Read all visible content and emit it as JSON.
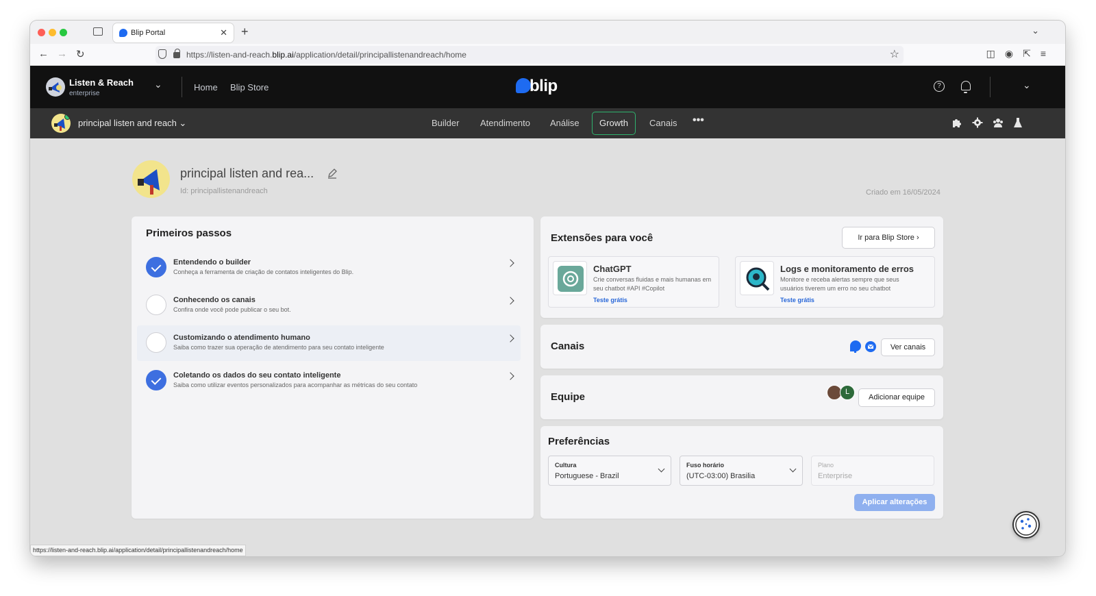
{
  "browser": {
    "tab_title": "Blip Portal",
    "url_prefix": "https://listen-and-reach.",
    "url_domain": "blip.ai",
    "url_path": "/application/detail/principallistenandreach/home",
    "status_url": "https://listen-and-reach.blip.ai/application/detail/principallistenandreach/home"
  },
  "topnav": {
    "tenant_name": "Listen & Reach",
    "tenant_plan": "enterprise",
    "links": [
      "Home",
      "Blip Store"
    ],
    "brand": "blip"
  },
  "subnav": {
    "bot_name": "principal listen and reach",
    "items": [
      "Builder",
      "Atendimento",
      "Análise",
      "Growth",
      "Canais"
    ],
    "active": "Growth"
  },
  "header": {
    "title": "principal listen and rea...",
    "id_text": "Id: principallistenandreach",
    "created_text": "Criado em  16/05/2024"
  },
  "first_steps": {
    "title": "Primeiros passos",
    "steps": [
      {
        "title": "Entendendo o builder",
        "desc": "Conheça a ferramenta de criação de contatos inteligentes do Blip.",
        "done": true
      },
      {
        "title": "Conhecendo os canais",
        "desc": "Confira onde você pode publicar o seu bot.",
        "done": false
      },
      {
        "title": "Customizando o atendimento humano",
        "desc": "Saiba como trazer sua operação de atendimento para seu contato inteligente",
        "done": false
      },
      {
        "title": "Coletando os dados do seu contato inteligente",
        "desc": "Saiba como utilizar eventos personalizados para acompanhar as métricas do seu contato",
        "done": true
      }
    ]
  },
  "extensions": {
    "title": "Extensões para você",
    "store_button": "Ir para Blip Store",
    "items": [
      {
        "title": "ChatGPT",
        "desc": "Crie conversas fluidas e mais humanas em seu chatbot #API #Copilot",
        "link": "Teste grátis"
      },
      {
        "title": "Logs e monitoramento de erros",
        "desc": "Monitore e receba alertas sempre que seus usuários tiverem um erro no seu chatbot",
        "link": "Teste grátis"
      }
    ]
  },
  "channels": {
    "title": "Canais",
    "button": "Ver canais"
  },
  "team": {
    "title": "Equipe",
    "button": "Adicionar equipe",
    "avatar_initial": "L"
  },
  "preferences": {
    "title": "Preferências",
    "fields": [
      {
        "label": "Cultura",
        "value": "Portuguese - Brazil"
      },
      {
        "label": "Fuso horário",
        "value": "(UTC-03:00) Brasilia"
      },
      {
        "label": "Plano",
        "value": "Enterprise"
      }
    ],
    "apply_button": "Aplicar alterações"
  },
  "colors": {
    "brand_blue": "#1e6bf1",
    "active_green": "#2fb36e",
    "check_blue": "#3d6fe0",
    "top_bar": "#111111",
    "sub_bar": "#333333"
  }
}
